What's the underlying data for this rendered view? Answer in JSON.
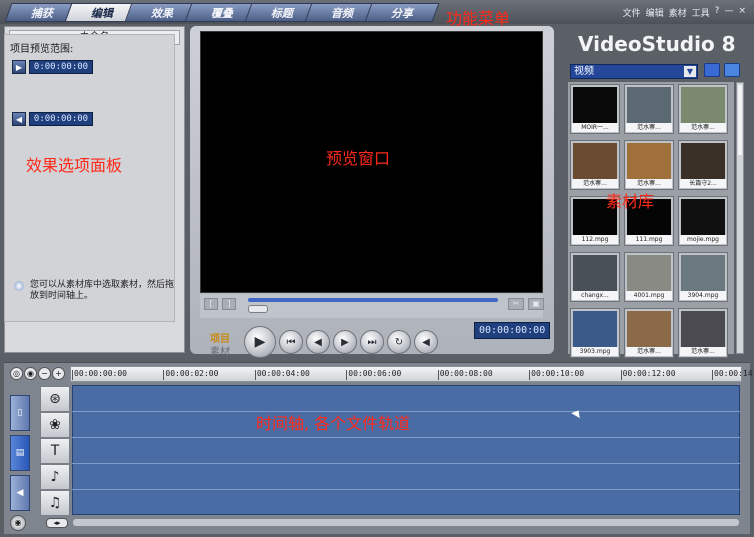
{
  "tabs": [
    {
      "label": "捕获",
      "active": false
    },
    {
      "label": "编辑",
      "active": true
    },
    {
      "label": "效果",
      "active": false
    },
    {
      "label": "覆叠",
      "active": false
    },
    {
      "label": "标题",
      "active": false
    },
    {
      "label": "音频",
      "active": false
    },
    {
      "label": "分享",
      "active": false
    }
  ],
  "app_menu": [
    "文件",
    "编辑",
    "素材",
    "工具",
    "?",
    "—",
    "×"
  ],
  "annotations": {
    "menu": "功能菜单",
    "effects_panel": "效果选项面板",
    "preview": "预览窗口",
    "library": "素材库",
    "timeline": "时间轴, 各个文件轨道"
  },
  "left_panel": {
    "project_name": "未命名",
    "range_label": "项目预览范围:",
    "start_tc": "0:00:00:00",
    "end_tc": "0:00:00:00",
    "hint": "您可以从素材库中选取素材，然后拖放到时间轴上。"
  },
  "preview": {
    "mode_project": "项目",
    "mode_clip": "素材",
    "timecode": "00:00:00:00",
    "icons": [
      "play-icon",
      "home-icon",
      "prev-frame-icon",
      "next-frame-icon",
      "end-icon",
      "repeat-icon",
      "volume-icon"
    ]
  },
  "brand": "VideoStudio 8",
  "library": {
    "category": "视频",
    "items": [
      {
        "caption": "MOIR一...",
        "color": "#0a0a0a"
      },
      {
        "caption": "范水寨...",
        "color": "#5b6a72"
      },
      {
        "caption": "范水寨...",
        "color": "#7b8a6e"
      },
      {
        "caption": "范水寨...",
        "color": "#6a4a30"
      },
      {
        "caption": "范水寨...",
        "color": "#a0703a"
      },
      {
        "caption": "长篇守2...",
        "color": "#3a3028"
      },
      {
        "caption": "112.mpg",
        "color": "#050505"
      },
      {
        "caption": "111.mpg",
        "color": "#050505"
      },
      {
        "caption": "mojie.mpg",
        "color": "#101010"
      },
      {
        "caption": "changx...",
        "color": "#4a5058"
      },
      {
        "caption": "4001.mpg",
        "color": "#8a8a84"
      },
      {
        "caption": "3904.mpg",
        "color": "#6a7880"
      },
      {
        "caption": "3903.mpg",
        "color": "#3a5a8a"
      },
      {
        "caption": "范水寨...",
        "color": "#8a6a48"
      },
      {
        "caption": "范水寨...",
        "color": "#4a4a50"
      }
    ]
  },
  "timeline": {
    "ticks": [
      "00:00:00:00",
      "00:00:02:00",
      "00:00:04:00",
      "00:00:06:00",
      "00:00:08:00",
      "00:00:10:00",
      "00:00:12:00",
      "00:00:14:00"
    ],
    "track_icons": [
      "video-track-icon",
      "overlay-track-icon",
      "title-track-icon",
      "voice-track-icon",
      "music-track-icon"
    ],
    "track_glyphs": [
      "⊛",
      "❀",
      "T",
      "♪",
      "♫"
    ]
  }
}
